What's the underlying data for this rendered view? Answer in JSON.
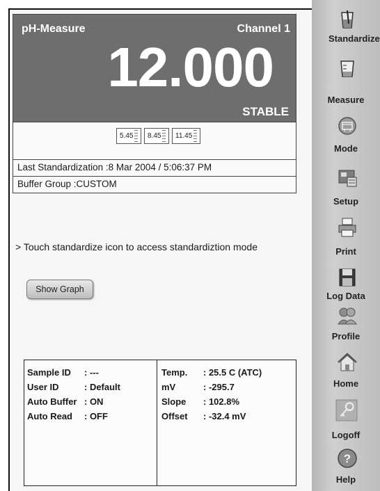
{
  "measurement": {
    "title": "pH-Measure",
    "channel": "Channel 1",
    "value": "12.000",
    "status": "STABLE"
  },
  "buffers": [
    "5.45",
    "8.45",
    "11.45"
  ],
  "info": {
    "last_standardization": "Last Standardization :8 Mar 2004 / 5:06:37 PM",
    "buffer_group": "Buffer Group :CUSTOM"
  },
  "hint": "> Touch standardize icon to access standardiztion mode",
  "show_graph_label": "Show Graph",
  "details": {
    "left": [
      {
        "label": "Sample ID",
        "value": ":   ---"
      },
      {
        "label": "User ID",
        "value": "  : Default"
      },
      {
        "label": "Auto Buffer",
        "value": ": ON"
      },
      {
        "label": "Auto Read",
        "value": " : OFF"
      }
    ],
    "right": [
      {
        "label": "Temp.",
        "value": ": 25.5 C (ATC)"
      },
      {
        "label": "mV",
        "value": ":  -295.7"
      },
      {
        "label": "Slope",
        "value": ":  102.8%"
      },
      {
        "label": "Offset",
        "value": ":  -32.4 mV"
      }
    ]
  },
  "sidebar": {
    "items": [
      {
        "label": "Standardize",
        "icon": "beaker-standardize-icon"
      },
      {
        "label": "Measure",
        "icon": "beaker-measure-icon"
      },
      {
        "label": "Mode",
        "icon": "mode-icon"
      },
      {
        "label": "Setup",
        "icon": "setup-icon"
      },
      {
        "label": "Print",
        "icon": "printer-icon"
      },
      {
        "label": "Log Data",
        "icon": "floppy-disk-icon"
      },
      {
        "label": "Profile",
        "icon": "users-icon"
      },
      {
        "label": "Home",
        "icon": "home-icon"
      },
      {
        "label": "Logoff",
        "icon": "key-icon"
      },
      {
        "label": "Help",
        "icon": "help-icon"
      }
    ]
  },
  "colors": {
    "panel": "#6e6e6e",
    "sidebar": "#c4c4c4",
    "text": "#1a1a1a"
  }
}
